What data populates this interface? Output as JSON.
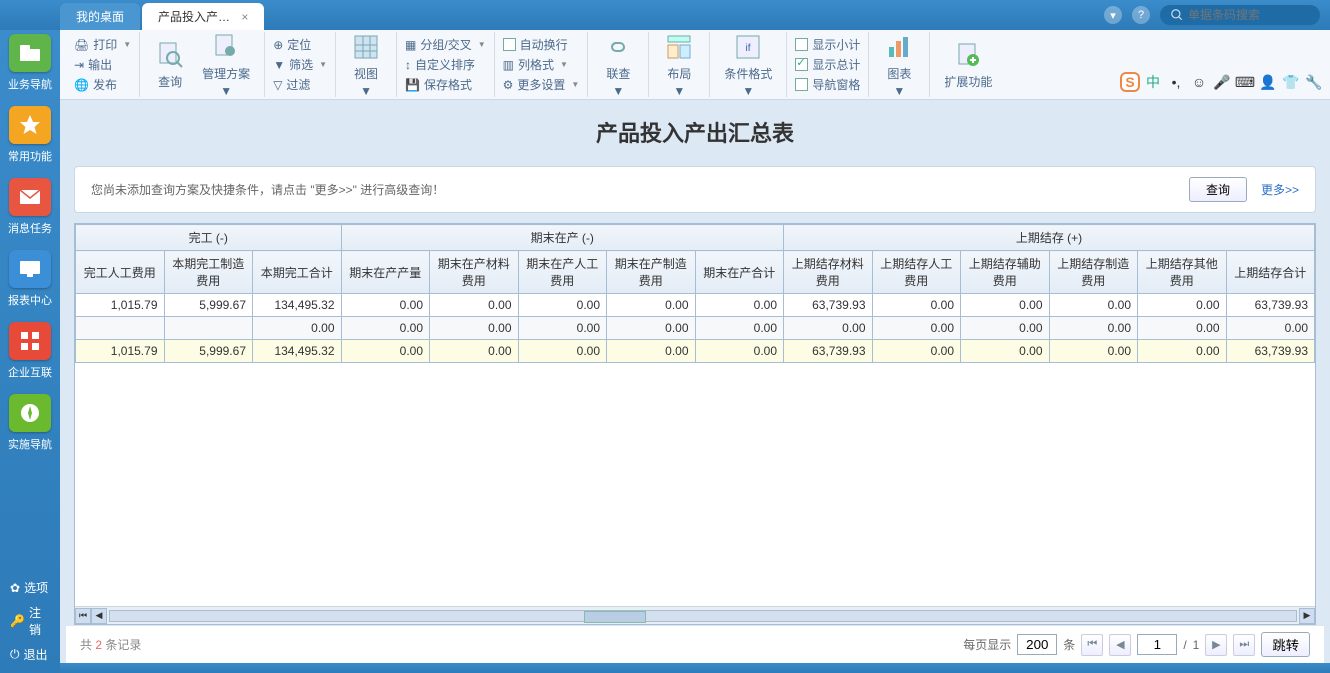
{
  "titlebar": {
    "tabs": [
      {
        "label": "我的桌面",
        "active": false
      },
      {
        "label": "产品投入产…",
        "active": true
      }
    ],
    "search_placeholder": "单据条码搜索"
  },
  "sidebar": {
    "items": [
      {
        "label": "业务导航",
        "color": "#5fb54a"
      },
      {
        "label": "常用功能",
        "color": "#f4a522"
      },
      {
        "label": "消息任务",
        "color": "#e85642"
      },
      {
        "label": "报表中心",
        "color": "#3a8fd6"
      },
      {
        "label": "企业互联",
        "color": "#e84a3a"
      },
      {
        "label": "实施导航",
        "color": "#6ab92e"
      }
    ],
    "bottom": [
      {
        "label": "选项"
      },
      {
        "label": "注销"
      },
      {
        "label": "退出"
      }
    ]
  },
  "ribbon": {
    "g1": {
      "print": "打印",
      "export": "输出",
      "publish": "发布"
    },
    "g2": {
      "query": "查询",
      "plan": "管理方案"
    },
    "g3": {
      "locate": "定位",
      "filter": "筛选",
      "clear": "过滤"
    },
    "g4": {
      "view": "视图"
    },
    "g5": {
      "group": "分组/交叉",
      "sort": "自定义排序",
      "save": "保存格式"
    },
    "g6": {
      "autowrap": "自动换行",
      "colfmt": "列格式",
      "more": "更多设置"
    },
    "g7": {
      "link": "联查"
    },
    "g8": {
      "layout": "布局"
    },
    "g9": {
      "condfmt": "条件格式"
    },
    "g10": {
      "subtotal": "显示小计",
      "total": "显示总计",
      "navpane": "导航窗格"
    },
    "g11": {
      "chart": "图表"
    },
    "g12": {
      "extend": "扩展功能"
    }
  },
  "report": {
    "title": "产品投入产出汇总表",
    "hint": "您尚未添加查询方案及快捷条件，请点击 \"更多>>\" 进行高级查询！",
    "query_btn": "查询",
    "more_link": "更多>>"
  },
  "table": {
    "groups": [
      {
        "label": "完工 (-)",
        "span": 3
      },
      {
        "label": "期末在产 (-)",
        "span": 5
      },
      {
        "label": "上期结存 (+)",
        "span": 6
      }
    ],
    "headers": [
      "完工人工费用",
      "本期完工制造费用",
      "本期完工合计",
      "期末在产产量",
      "期末在产材料费用",
      "期末在产人工费用",
      "期末在产制造费用",
      "期末在产合计",
      "上期结存材料费用",
      "上期结存人工费用",
      "上期结存辅助费用",
      "上期结存制造费用",
      "上期结存其他费用",
      "上期结存合计"
    ],
    "rows": [
      [
        "1,015.79",
        "5,999.67",
        "134,495.32",
        "0.00",
        "0.00",
        "0.00",
        "0.00",
        "0.00",
        "63,739.93",
        "0.00",
        "0.00",
        "0.00",
        "0.00",
        "63,739.93"
      ],
      [
        "",
        "",
        "0.00",
        "0.00",
        "0.00",
        "0.00",
        "0.00",
        "0.00",
        "0.00",
        "0.00",
        "0.00",
        "0.00",
        "0.00",
        "0.00"
      ],
      [
        "1,015.79",
        "5,999.67",
        "134,495.32",
        "0.00",
        "0.00",
        "0.00",
        "0.00",
        "0.00",
        "63,739.93",
        "0.00",
        "0.00",
        "0.00",
        "0.00",
        "63,739.93"
      ]
    ]
  },
  "footer": {
    "total_prefix": "共 ",
    "total_count": "2",
    "total_suffix": " 条记录",
    "perpage_label": "每页显示",
    "perpage_value": "200",
    "perpage_unit": "条",
    "page_value": "1",
    "page_sep": "/",
    "page_total": "1",
    "jump": "跳转"
  },
  "ime": {
    "label": "中"
  }
}
